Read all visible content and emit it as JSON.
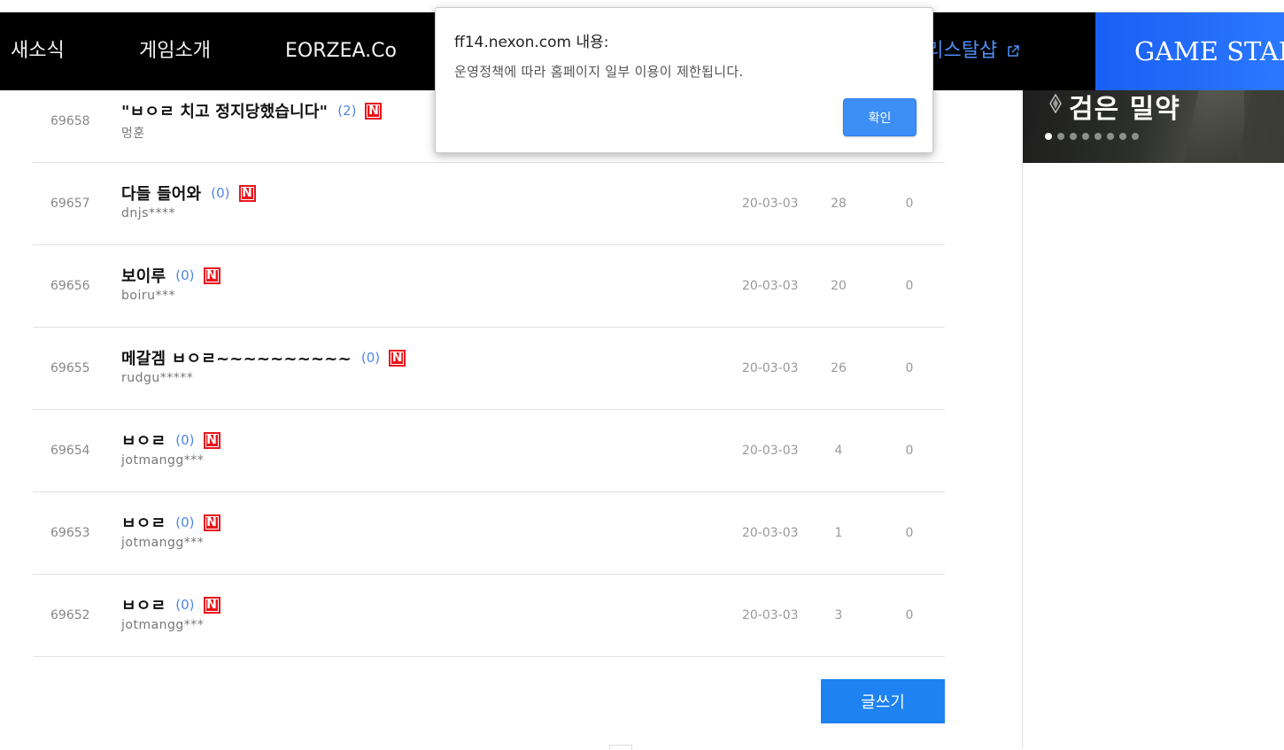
{
  "nav": {
    "items": [
      "새소식",
      "게임소개",
      "EORZEA.Co"
    ],
    "external_link": "크리스탈샵",
    "game_start": "GAME START"
  },
  "banner": {
    "title": "검은 밀약",
    "dot_count": 8,
    "active_dot": 0
  },
  "posts": [
    {
      "num": "69658",
      "title": "\"ㅂㅇㄹ 치고 정지당했습니다\"",
      "comments": "(2)",
      "badge": "N",
      "author": "멍훈",
      "date": "",
      "views": "",
      "likes": ""
    },
    {
      "num": "69657",
      "title": "다들 들어와",
      "comments": "(0)",
      "badge": "N",
      "author": "dnjs****",
      "date": "20-03-03",
      "views": "28",
      "likes": "0"
    },
    {
      "num": "69656",
      "title": "보이루",
      "comments": "(0)",
      "badge": "N",
      "author": "boiru***",
      "date": "20-03-03",
      "views": "20",
      "likes": "0"
    },
    {
      "num": "69655",
      "title": "메갈겜 ㅂㅇㄹ~~~~~~~~~~",
      "comments": "(0)",
      "badge": "N",
      "author": "rudgu*****",
      "date": "20-03-03",
      "views": "26",
      "likes": "0"
    },
    {
      "num": "69654",
      "title": "ㅂㅇㄹ",
      "comments": "(0)",
      "badge": "N",
      "author": "jotmangg***",
      "date": "20-03-03",
      "views": "4",
      "likes": "0"
    },
    {
      "num": "69653",
      "title": "ㅂㅇㄹ",
      "comments": "(0)",
      "badge": "N",
      "author": "jotmangg***",
      "date": "20-03-03",
      "views": "1",
      "likes": "0"
    },
    {
      "num": "69652",
      "title": "ㅂㅇㄹ",
      "comments": "(0)",
      "badge": "N",
      "author": "jotmangg***",
      "date": "20-03-03",
      "views": "3",
      "likes": "0"
    }
  ],
  "write_button": "글쓰기",
  "dialog": {
    "title": "ff14.nexon.com 내용:",
    "message": "운영정책에 따라 홈페이지 일부 이용이 제한됩니다.",
    "ok": "확인"
  },
  "colors": {
    "accent_blue": "#1e82f0",
    "badge_red": "#e8151c",
    "comment_blue": "#4f86e6",
    "nav_bg": "#000000"
  }
}
